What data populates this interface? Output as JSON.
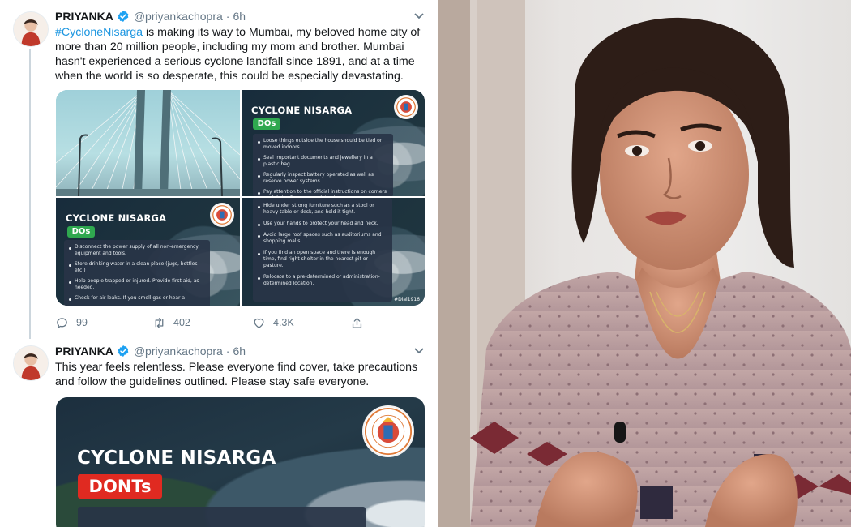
{
  "tweets": [
    {
      "name": "PRIYANKA",
      "handle": "@priyankachopra",
      "time": "6h",
      "hashtag": "#CycloneNisarga",
      "text": " is making its way to Mumbai, my beloved home city of more than 20 million people, including my mom and brother. Mumbai hasn't experienced a serious cyclone landfall since 1891, and at a time when the world is so desperate, this could be especially devastating.",
      "images": {
        "top_right": {
          "title": "CYCLONE NISARGA",
          "tag": "DOs",
          "items": [
            "Loose things outside the house should be tied or moved indoors.",
            "Seal important documents and jewellery in a plastic bag.",
            "Regularly inspect battery operated as well as reserve power systems.",
            "Pay attention to the official instructions on corners as debris often accumulates in corners."
          ]
        },
        "bottom_left": {
          "title": "CYCLONE NISARGA",
          "tag": "DOs",
          "items": [
            "Disconnect the power supply of all non-emergency equipment and tools.",
            "Store drinking water in a clean place (jugs, bottles etc.)",
            "Help people trapped or injured. Provide first aid, as needed.",
            "Check for air leaks. If you smell gas or hear a"
          ]
        },
        "bottom_right": {
          "items": [
            "Hide under strong furniture such as a stool or heavy table or desk, and hold it tight.",
            "Use your hands to protect your head and neck.",
            "Avoid large roof spaces such as auditoriums and shopping malls.",
            "If you find an open space and there is enough time, find right shelter in the nearest pit or pasture.",
            "Relocate to a pre-determined or administration-determined location."
          ],
          "dial": "#Dial1916"
        }
      },
      "actions": {
        "replies": "99",
        "retweets": "402",
        "likes": "4.3K"
      }
    },
    {
      "name": "PRIYANKA",
      "handle": "@priyankachopra",
      "time": "6h",
      "text": "This year feels relentless. Please everyone find cover, take precautions and follow the guidelines outlined. Please stay safe everyone.",
      "image": {
        "title": "CYCLONE NISARGA",
        "tag": "DONTs"
      }
    }
  ],
  "colors": {
    "link": "#1b95e0",
    "verified": "#1da1f2",
    "muted": "#657786",
    "dos_green": "#2fa84f",
    "donts_red": "#e02a21"
  },
  "icons": [
    "verified-badge-icon",
    "chevron-down-icon",
    "reply-icon",
    "retweet-icon",
    "like-icon",
    "share-icon",
    "bmc-seal-icon"
  ]
}
